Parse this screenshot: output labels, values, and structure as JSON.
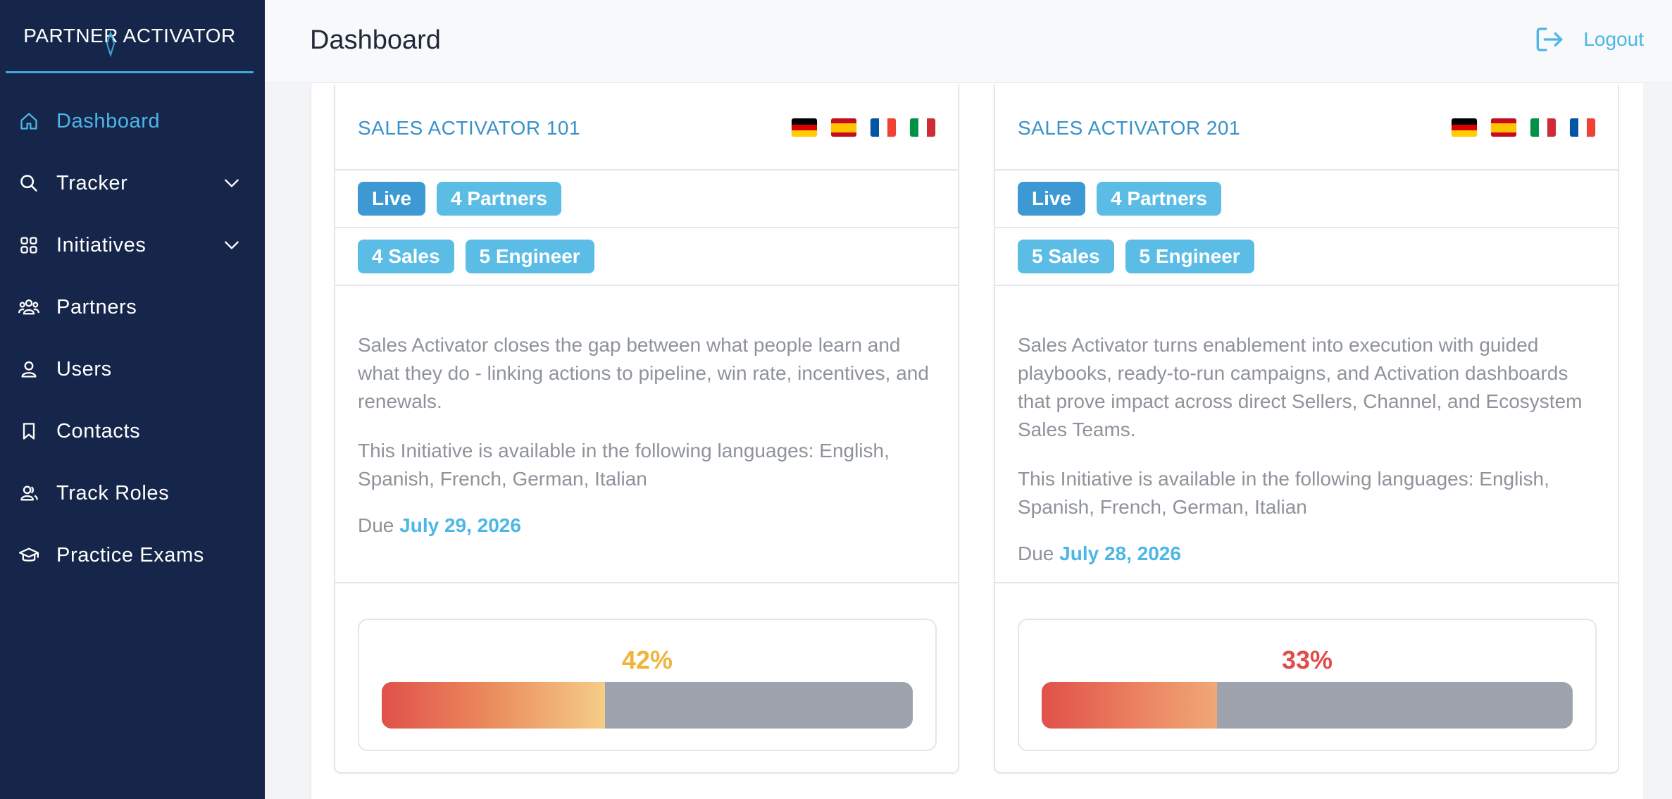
{
  "brand": {
    "name": "PARTNER ACTIVATOR"
  },
  "sidebar": {
    "items": [
      {
        "label": "Dashboard",
        "icon": "home-icon",
        "active": true
      },
      {
        "label": "Tracker",
        "icon": "search-icon",
        "expandable": true
      },
      {
        "label": "Initiatives",
        "icon": "grid-icon",
        "expandable": true
      },
      {
        "label": "Partners",
        "icon": "group-icon"
      },
      {
        "label": "Users",
        "icon": "user-icon"
      },
      {
        "label": "Contacts",
        "icon": "bookmark-icon"
      },
      {
        "label": "Track Roles",
        "icon": "users-icon"
      },
      {
        "label": "Practice Exams",
        "icon": "graduation-cap-icon"
      }
    ]
  },
  "header": {
    "title": "Dashboard",
    "logout_label": "Logout"
  },
  "colors": {
    "sidebar_bg": "#16254a",
    "accent": "#4cb6e6",
    "badge_live": "#3d99d4",
    "badge_info": "#5bbde6",
    "pct_amber": "#f0b43c",
    "pct_red": "#e04e4a"
  },
  "cards": [
    {
      "title": "SALES ACTIVATOR 101",
      "flags": [
        "germany-flag",
        "spain-flag",
        "france-flag",
        "italy-flag"
      ],
      "status": "Live",
      "partners": "4 Partners",
      "sales": "4 Sales",
      "engineers": "5 Engineer",
      "description": "Sales Activator closes the gap between what people learn and what they do - linking actions to pipeline, win rate, incentives, and renewals.",
      "languages": "This Initiative is available in the following languages: English, Spanish, French, German, Italian",
      "due_prefix": "Due",
      "due_date": "July 29, 2026",
      "progress_label": "42%",
      "progress": 0.42
    },
    {
      "title": "SALES ACTIVATOR 201",
      "flags": [
        "germany-flag",
        "spain-flag",
        "italy-flag",
        "france-flag"
      ],
      "status": "Live",
      "partners": "4 Partners",
      "sales": "5 Sales",
      "engineers": "5 Engineer",
      "description": "Sales Activator turns enablement into execution with guided playbooks, ready-to-run campaigns, and Activation dashboards that prove impact across direct Sellers, Channel, and Ecosystem Sales Teams.",
      "languages": "This Initiative is available in the following languages: English, Spanish, French, German, Italian",
      "due_prefix": "Due",
      "due_date": "July 28, 2026",
      "progress_label": "33%",
      "progress": 0.33
    }
  ]
}
